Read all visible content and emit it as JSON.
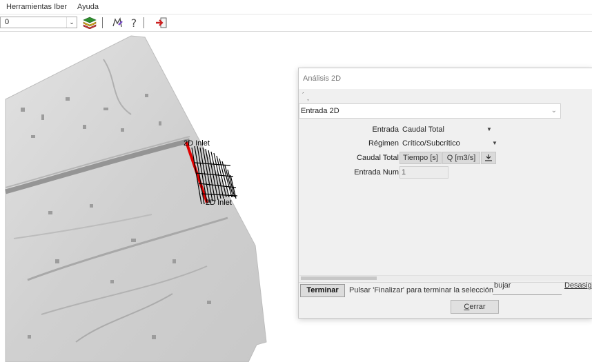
{
  "menu": {
    "items": [
      "Herramientas Iber",
      "Ayuda"
    ]
  },
  "toolbar": {
    "layer_value": "0",
    "icons": [
      "layers-icon",
      "draw-tool-icon",
      "help-icon",
      "exit-icon"
    ]
  },
  "viewport": {
    "inlet_labels": [
      "2D Inlet",
      "2D Inlet"
    ]
  },
  "dialog": {
    "title": "Análisis 2D",
    "tick_mark": "´",
    "tick_mark2": ",",
    "condition_combo": "Entrada 2D",
    "fields": {
      "entrada_label": "Entrada",
      "entrada_value": "Caudal Total",
      "regimen_label": "Régimen",
      "regimen_value": "Crítico/Subcrítico",
      "caudal_label": "Caudal Total",
      "tiempo_header": "Tiempo [s]",
      "q_header": "Q [m3/s]",
      "entrada_num_label": "Entrada Num",
      "entrada_num_value": "1"
    },
    "bottom": {
      "terminar": "Terminar",
      "hint": "Pulsar 'Finalizar' para terminar la selección",
      "dibujar": "bujar",
      "desasignar": "Desasign"
    },
    "close_prefix": "C",
    "close_rest": "errar"
  },
  "colors": {
    "inlet_line": "#e00000",
    "terrain": "#d6d6d6",
    "dialog_bg": "#f0f0f0"
  }
}
